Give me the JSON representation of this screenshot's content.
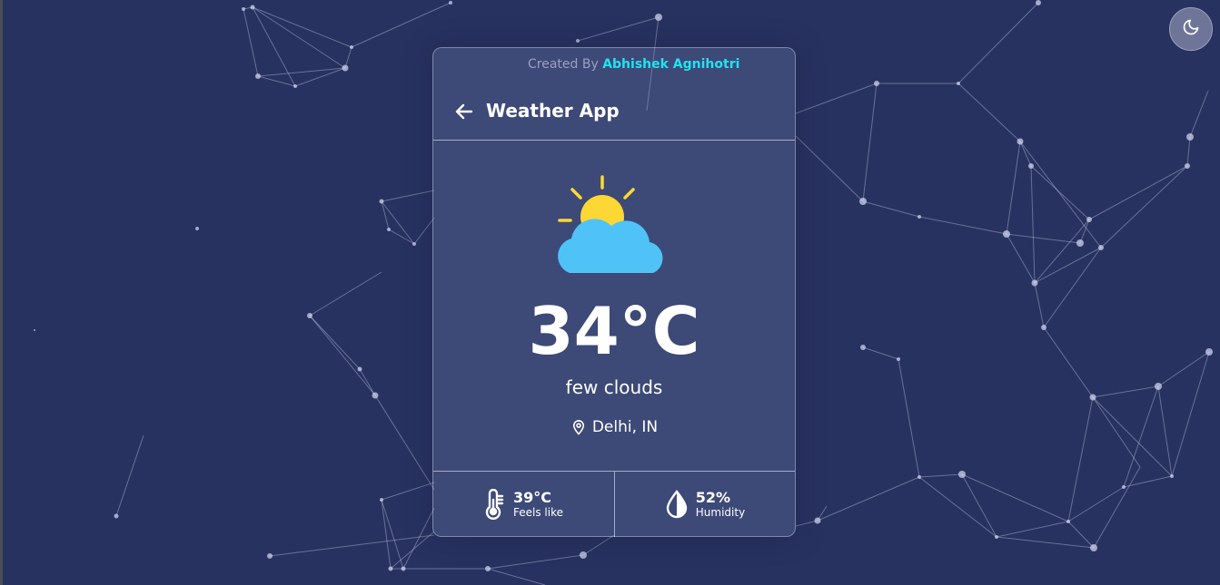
{
  "credit": {
    "prefix": "Created By",
    "author": "Abhishek Agnihotri"
  },
  "header": {
    "title": "Weather App",
    "back_icon": "arrow-left-icon"
  },
  "theme_toggle": {
    "icon": "moon-icon"
  },
  "current": {
    "icon": "sun-behind-cloud-icon",
    "temperature": "34°C",
    "description": "few clouds",
    "location": "Delhi, IN",
    "location_icon": "map-pin-icon"
  },
  "stats": {
    "feels_like": {
      "value": "39°C",
      "label": "Feels like",
      "icon": "thermometer-icon"
    },
    "humidity": {
      "value": "52%",
      "label": "Humidity",
      "icon": "droplet-icon"
    }
  },
  "colors": {
    "background": "#283260",
    "author_accent": "#22e2f2",
    "sun": "#fdd835",
    "cloud": "#4fc3f7"
  }
}
